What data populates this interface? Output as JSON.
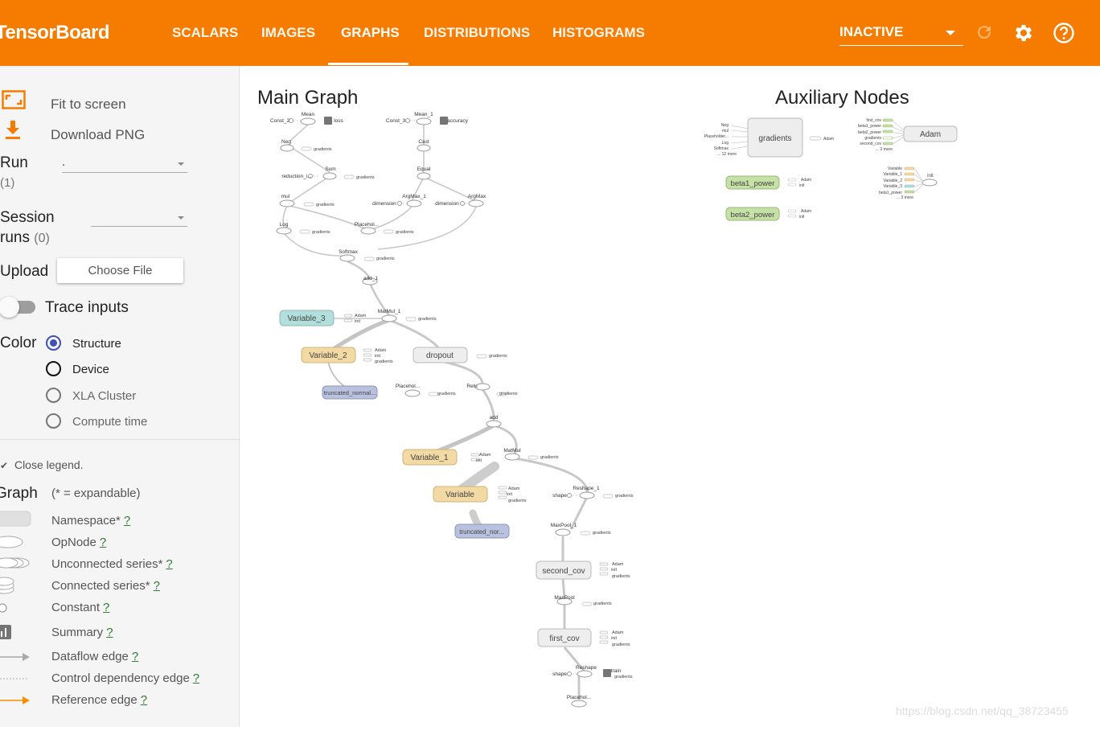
{
  "app": {
    "title": "TensorBoard"
  },
  "nav": {
    "tabs": [
      {
        "label": "SCALARS"
      },
      {
        "label": "IMAGES"
      },
      {
        "label": "GRAPHS"
      },
      {
        "label": "DISTRIBUTIONS"
      },
      {
        "label": "HISTOGRAMS"
      }
    ],
    "active_tab": "GRAPHS",
    "status_select": "INACTIVE"
  },
  "sidebar": {
    "fit_to_screen": "Fit to screen",
    "download_png": "Download PNG",
    "run_label": "Run",
    "run_count": "(1)",
    "run_value": ".",
    "session_label": "Session",
    "session_runs_label": "runs",
    "session_count": "(0)",
    "upload_label": "Upload",
    "choose_file": "Choose File",
    "trace_inputs": "Trace inputs",
    "color_label": "Color",
    "color_options": [
      "Structure",
      "Device",
      "XLA Cluster",
      "Compute time"
    ],
    "close_legend": "Close legend.",
    "graph_label": "Graph",
    "expandable_note": "(* = expandable)",
    "legend": [
      {
        "label": "Namespace*",
        "help": "?"
      },
      {
        "label": "OpNode",
        "help": "?"
      },
      {
        "label": "Unconnected series*",
        "help": "?"
      },
      {
        "label": "Connected series*",
        "help": "?"
      },
      {
        "label": "Constant",
        "help": "?"
      },
      {
        "label": "Summary",
        "help": "?"
      },
      {
        "label": "Dataflow edge",
        "help": "?"
      },
      {
        "label": "Control dependency edge",
        "help": "?"
      },
      {
        "label": "Reference edge",
        "help": "?"
      }
    ]
  },
  "main_graph": {
    "title": "Main Graph",
    "nodes": {
      "variable_3": "Variable_3",
      "variable_2": "Variable_2",
      "variable_1": "Variable_1",
      "variable": "Variable",
      "dropout": "dropout",
      "truncated_normal_a": "truncated_normal...",
      "truncated_normal_b": "truncated_nor...",
      "second_cov": "second_cov",
      "first_cov": "first_cov"
    },
    "ops": {
      "mean": "Mean",
      "mean_1": "Mean_1",
      "const_2": "Const_2",
      "const_3": "Const_3",
      "loss": "loss",
      "accuracy": "accuracy",
      "neg": "Neg",
      "cast": "Cast",
      "sum": "Sum",
      "reduction": "reduction_i...",
      "equal": "Equal",
      "mul": "mul",
      "argmax_1": "ArgMax_1",
      "argmax": "ArgMax",
      "dimension": "dimension",
      "log": "Log",
      "placeholder": "Placehol...",
      "softmax": "Softmax",
      "add_1": "add_1",
      "matmul_1": "MatMul_1",
      "relu": "Relu",
      "add": "add",
      "matmul": "MatMul",
      "reshape_1": "Reshape_1",
      "shape": "shape",
      "maxpool_1": "MaxPool_1",
      "maxpool": "MaxPool",
      "reshape": "Reshape",
      "train": "train",
      "gradients": "gradients",
      "adam": "Adam",
      "init": "init"
    }
  },
  "aux_graph": {
    "title": "Auxiliary Nodes",
    "gradients": "gradients",
    "adam": "Adam",
    "beta1_power": "beta1_power",
    "beta2_power": "beta2_power",
    "init": "init",
    "gradients_inputs": [
      "Neg",
      "mul",
      "Placeholder...",
      "Log",
      "Softmax",
      "... 12 more"
    ],
    "adam_inputs": [
      "first_cov",
      "beta1_power",
      "beta2_power",
      "gradients",
      "second_cov",
      "... 3 more"
    ],
    "init_inputs": [
      "Variable",
      "Variable_1",
      "Variable_2",
      "Variable_3",
      "beta1_power",
      "... 3 more"
    ]
  },
  "watermark": "https://blog.csdn.net/qq_38723455",
  "colors": {
    "header": "#f57c00",
    "variable_teal": "#b2dfdb",
    "variable_tan": "#f3d9a4",
    "truncated_blue": "#b8c1dd",
    "aux_green": "#c5e1a5",
    "radio_accent": "#3f51b5"
  }
}
